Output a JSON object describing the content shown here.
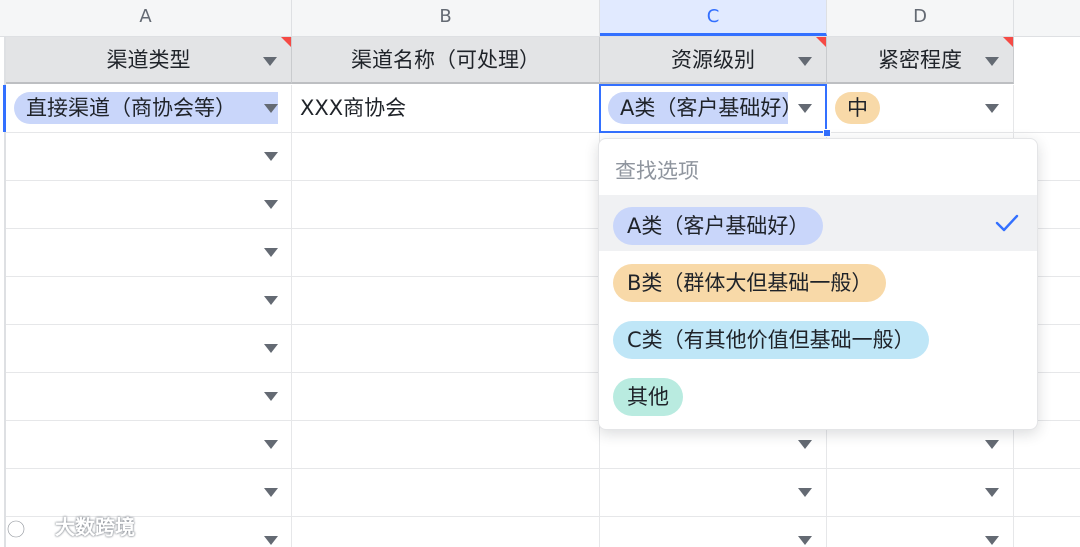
{
  "columns": [
    {
      "letter": "A"
    },
    {
      "letter": "B"
    },
    {
      "letter": "C"
    },
    {
      "letter": "D"
    }
  ],
  "headers": {
    "channel_type": "渠道类型",
    "channel_name": "渠道名称（可处理）",
    "resource_level": "资源级别",
    "urgency": "紧密程度"
  },
  "row1": {
    "channel_type": "直接渠道（商协会等）",
    "channel_name": "XXX商协会",
    "resource_level": "A类（客户基础好）",
    "urgency": "中"
  },
  "dropdown": {
    "search_placeholder": "查找选项",
    "options": [
      {
        "label": "A类（客户基础好）",
        "color": "#c9d6fa",
        "selected": true
      },
      {
        "label": "B类（群体大但基础一般）",
        "color": "#f8d9a8",
        "selected": false
      },
      {
        "label": "C类（有其他价值但基础一般）",
        "color": "#bfe6f7",
        "selected": false
      },
      {
        "label": "其他",
        "color": "#b9ebe0",
        "selected": false
      }
    ]
  },
  "colors": {
    "accent": "#3370ff",
    "tag_blue": "#c9d6fa",
    "tag_orange": "#f8d9a8",
    "header_corner": "#f54a45"
  },
  "watermark": {
    "text": "大数跨境"
  }
}
